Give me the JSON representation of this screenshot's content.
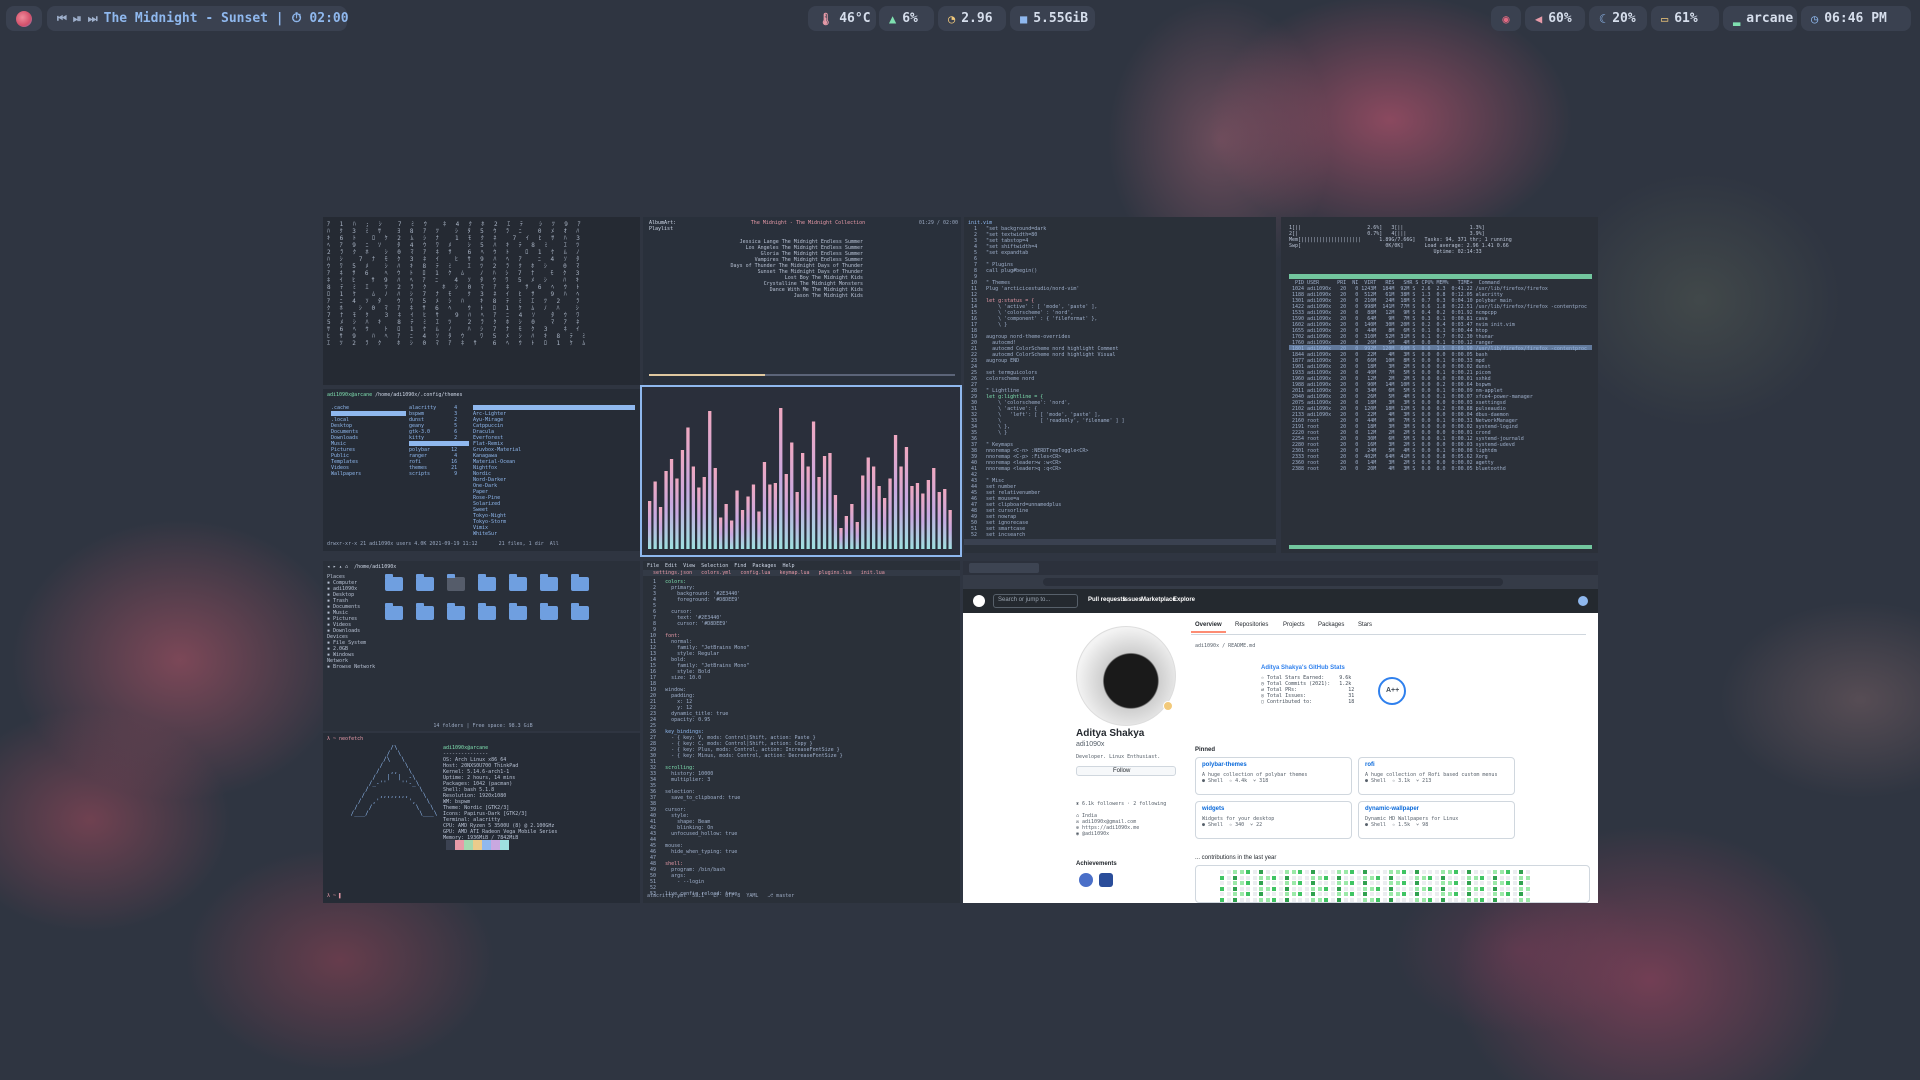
{
  "bar": {
    "media": {
      "title": "The Midnight - Sunset | ⏱ 02:00",
      "prev_icon": "⏮",
      "pause_icon": "⏯",
      "next_icon": "⏭"
    },
    "stats": {
      "temp": "46°C",
      "cpu": "6%",
      "load": "2.96",
      "disk": "5.55GiB"
    },
    "right": {
      "volume": "60%",
      "brightness": "20%",
      "battery": "61%",
      "network": "arcane",
      "clock": "06:46 PM"
    }
  },
  "music": {
    "now_playing": "The Midnight - The Midnight Collection",
    "tracks": [
      "Jessica Lange The Midnight Endless Summer",
      "Los Angeles The Midnight Endless Summer",
      "Gloria The Midnight Endless Summer",
      "Vampires The Midnight Endless Summer",
      "Days of Thunder The Midnight Days of Thunder",
      "Sunset The Midnight Days of Thunder",
      "Lost Boy The Midnight Kids",
      "Crystalline The Midnight Monsters",
      "Dance With Me The Midnight Kids",
      "Jason The Midnight Kids"
    ]
  },
  "github": {
    "name": "Aditya Shakya",
    "handle": "adi1090x",
    "search_placeholder": "Search or jump to...",
    "nav": [
      "Pull requests",
      "Issues",
      "Marketplace",
      "Explore"
    ],
    "tabs": [
      "Overview",
      "Repositories",
      "Projects",
      "Packages",
      "Stars"
    ],
    "follow_label": "Follow",
    "stats_card_title": "Aditya Shakya's GitHub Stats",
    "grade": "A++",
    "pinned_label": "Pinned",
    "pinned": [
      "polybar-themes",
      "rofi",
      "dynamic-wallpaper",
      "widgets"
    ],
    "achievements_label": "Achievements",
    "contributions": "... contributions in the last year"
  },
  "visualizer": {
    "bars": [
      0.32,
      0.45,
      0.28,
      0.52,
      0.6,
      0.47,
      0.66,
      0.81,
      0.55,
      0.41,
      0.48,
      0.92,
      0.54,
      0.21,
      0.3,
      0.19,
      0.39,
      0.26,
      0.35,
      0.43,
      0.25,
      0.58,
      0.43,
      0.44,
      0.94,
      0.5,
      0.71,
      0.38,
      0.64,
      0.55,
      0.85,
      0.48,
      0.62,
      0.64,
      0.36,
      0.14,
      0.22,
      0.3,
      0.18,
      0.49,
      0.61,
      0.55,
      0.42,
      0.34,
      0.47,
      0.76,
      0.55,
      0.68,
      0.42,
      0.44,
      0.37,
      0.46,
      0.54,
      0.38,
      0.4,
      0.26
    ]
  }
}
